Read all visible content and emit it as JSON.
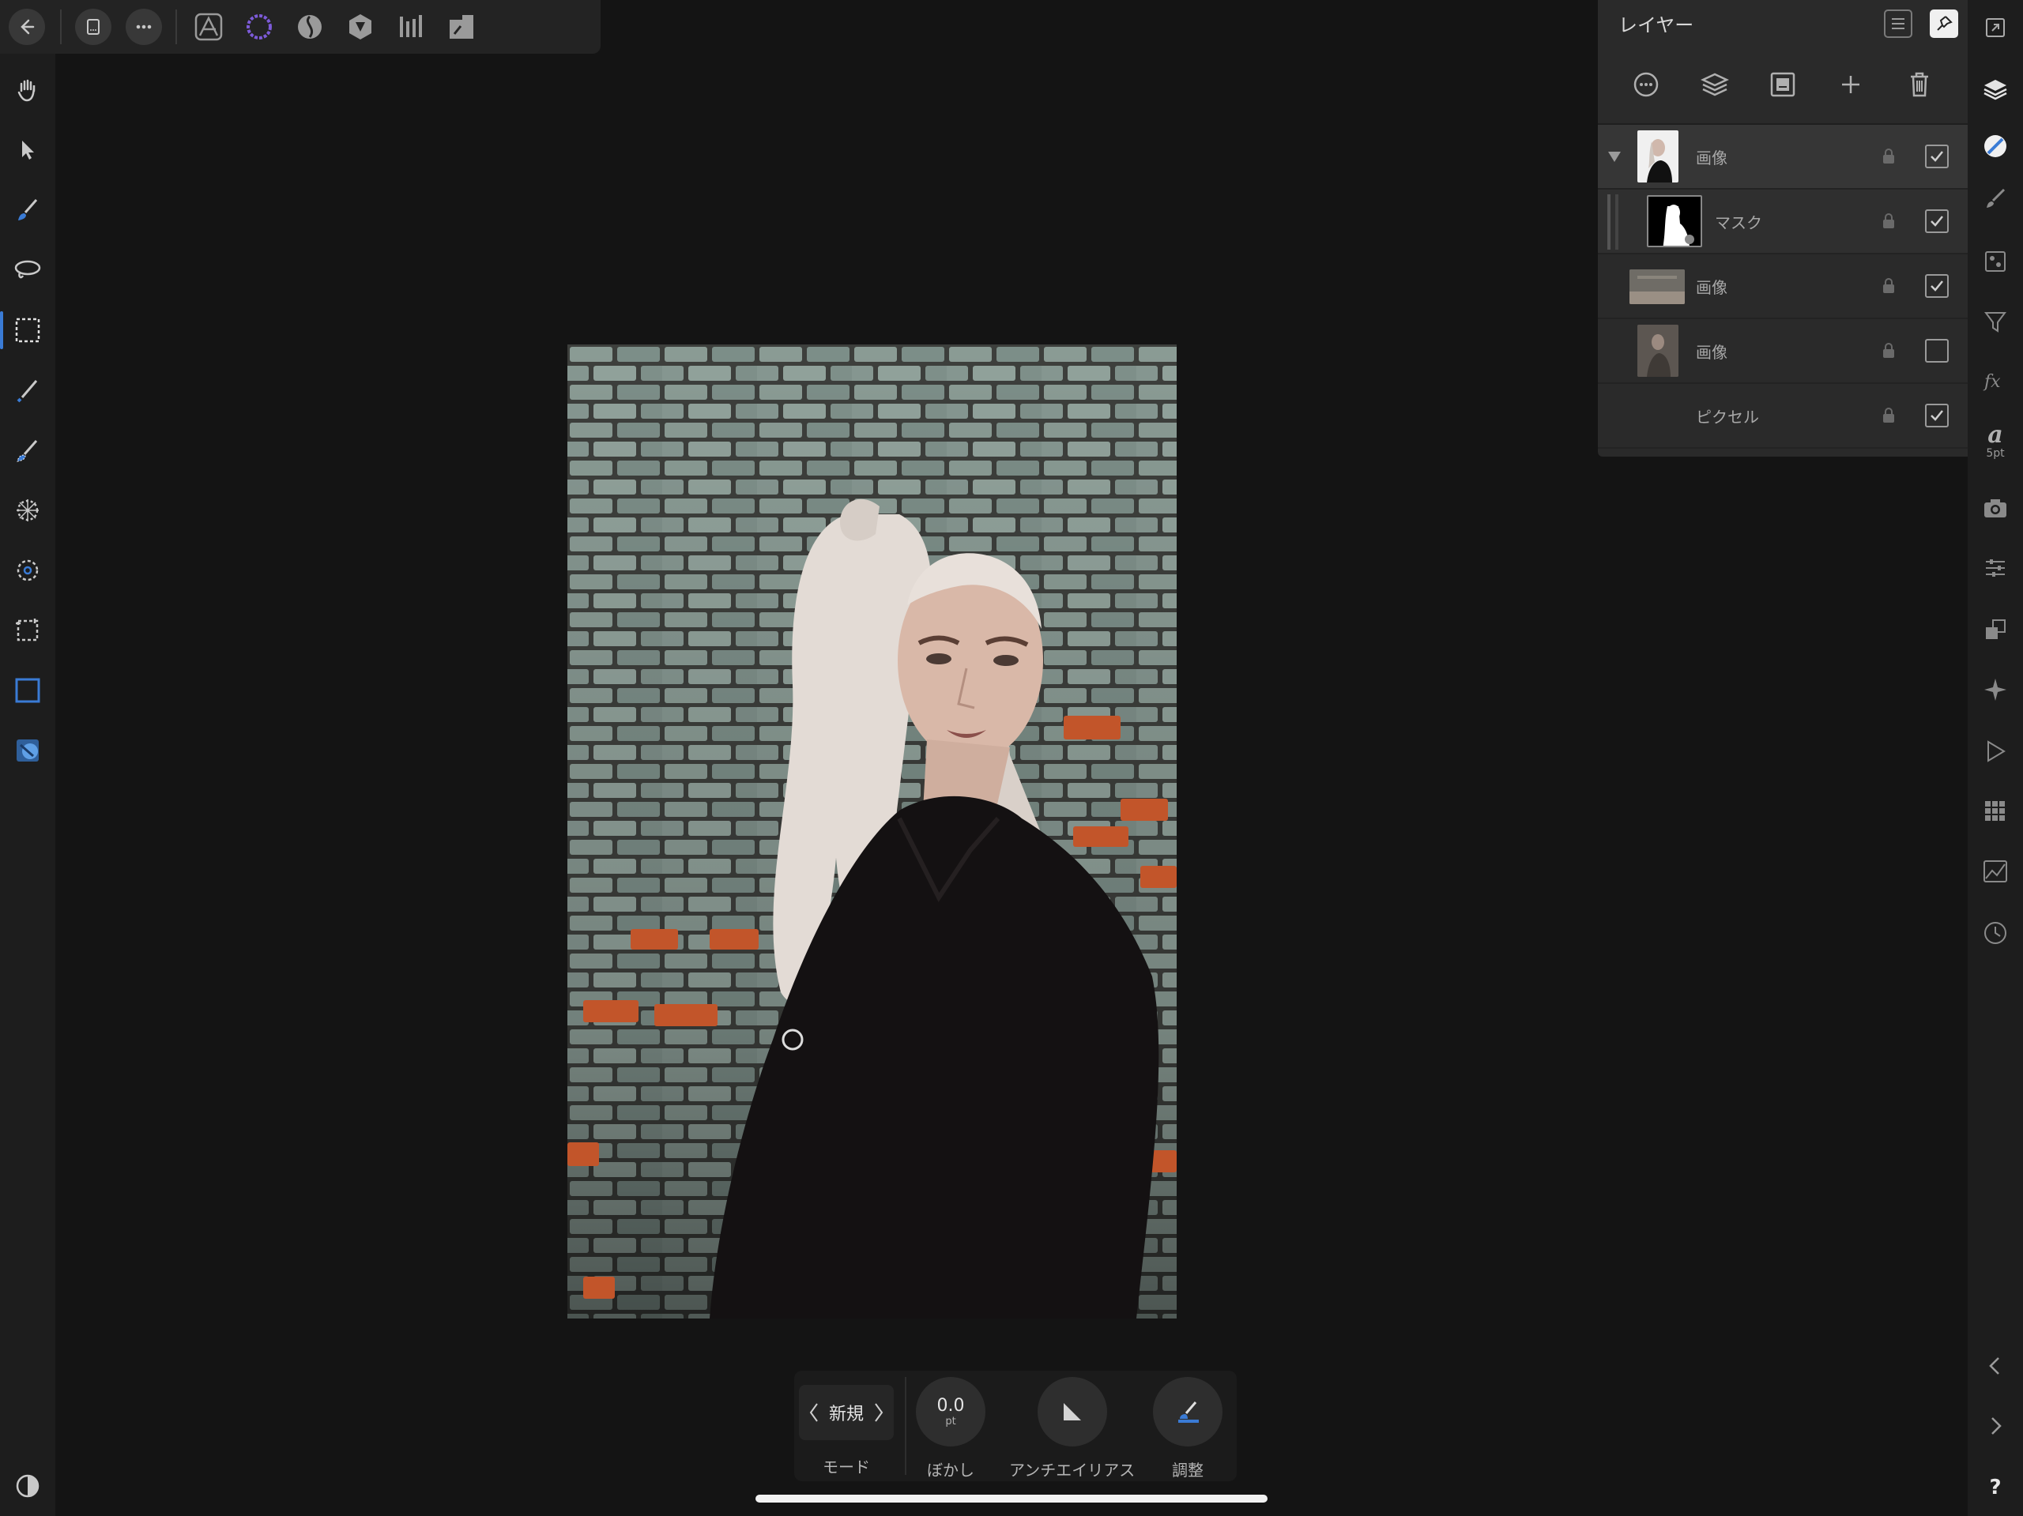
{
  "top_toolbar": {
    "items": [
      "back-icon",
      "document-icon",
      "more-icon",
      "photo-persona-icon",
      "selection-persona-icon",
      "liquify-persona-icon",
      "develop-persona-icon",
      "tone-mapping-persona-icon",
      "export-persona-icon"
    ]
  },
  "left_tools": [
    "hand-tool",
    "move-tool",
    "paint-brush-tool",
    "freehand-selection-tool",
    "marquee-selection-tool",
    "selection-brush-tool",
    "refine-brush-tool",
    "flood-select-tool",
    "sampled-color-tool",
    "crop-tool",
    "rectangle-selection-tool",
    "clone-tool",
    "contrast-toggle"
  ],
  "right_tools": [
    "fullscreen-icon",
    "layers-icon",
    "color-icon",
    "brushes-icon",
    "channels-icon",
    "filter-icon",
    "fx-icon",
    "text-style-icon",
    "camera-icon",
    "adjustments-icon",
    "transform-icon",
    "navigator-icon",
    "play-icon",
    "swatches-icon",
    "histogram-icon",
    "history-icon",
    "collapse-left-icon",
    "collapse-right-icon",
    "help-icon"
  ],
  "text_style": {
    "glyph": "a",
    "size": "5pt"
  },
  "help": "?",
  "layers_panel": {
    "title": "レイヤー",
    "layers": [
      {
        "name": "画像",
        "visible": true,
        "expanded": true,
        "selected": true
      },
      {
        "name": "マスク",
        "visible": true,
        "child": true
      },
      {
        "name": "画像",
        "visible": true
      },
      {
        "name": "画像",
        "visible": false
      },
      {
        "name": "ピクセル",
        "visible": true
      }
    ]
  },
  "context_toolbar": {
    "mode_value": "新規",
    "mode_label": "モード",
    "feather_value": "0.0",
    "feather_unit": "pt",
    "feather_label": "ぼかし",
    "antialias_label": "アンチエイリアス",
    "refine_label": "調整"
  },
  "colors": {
    "accent": "#3a7bd5",
    "background": "#141414",
    "panel": "#2a2a2a",
    "toolbar": "#232323"
  }
}
